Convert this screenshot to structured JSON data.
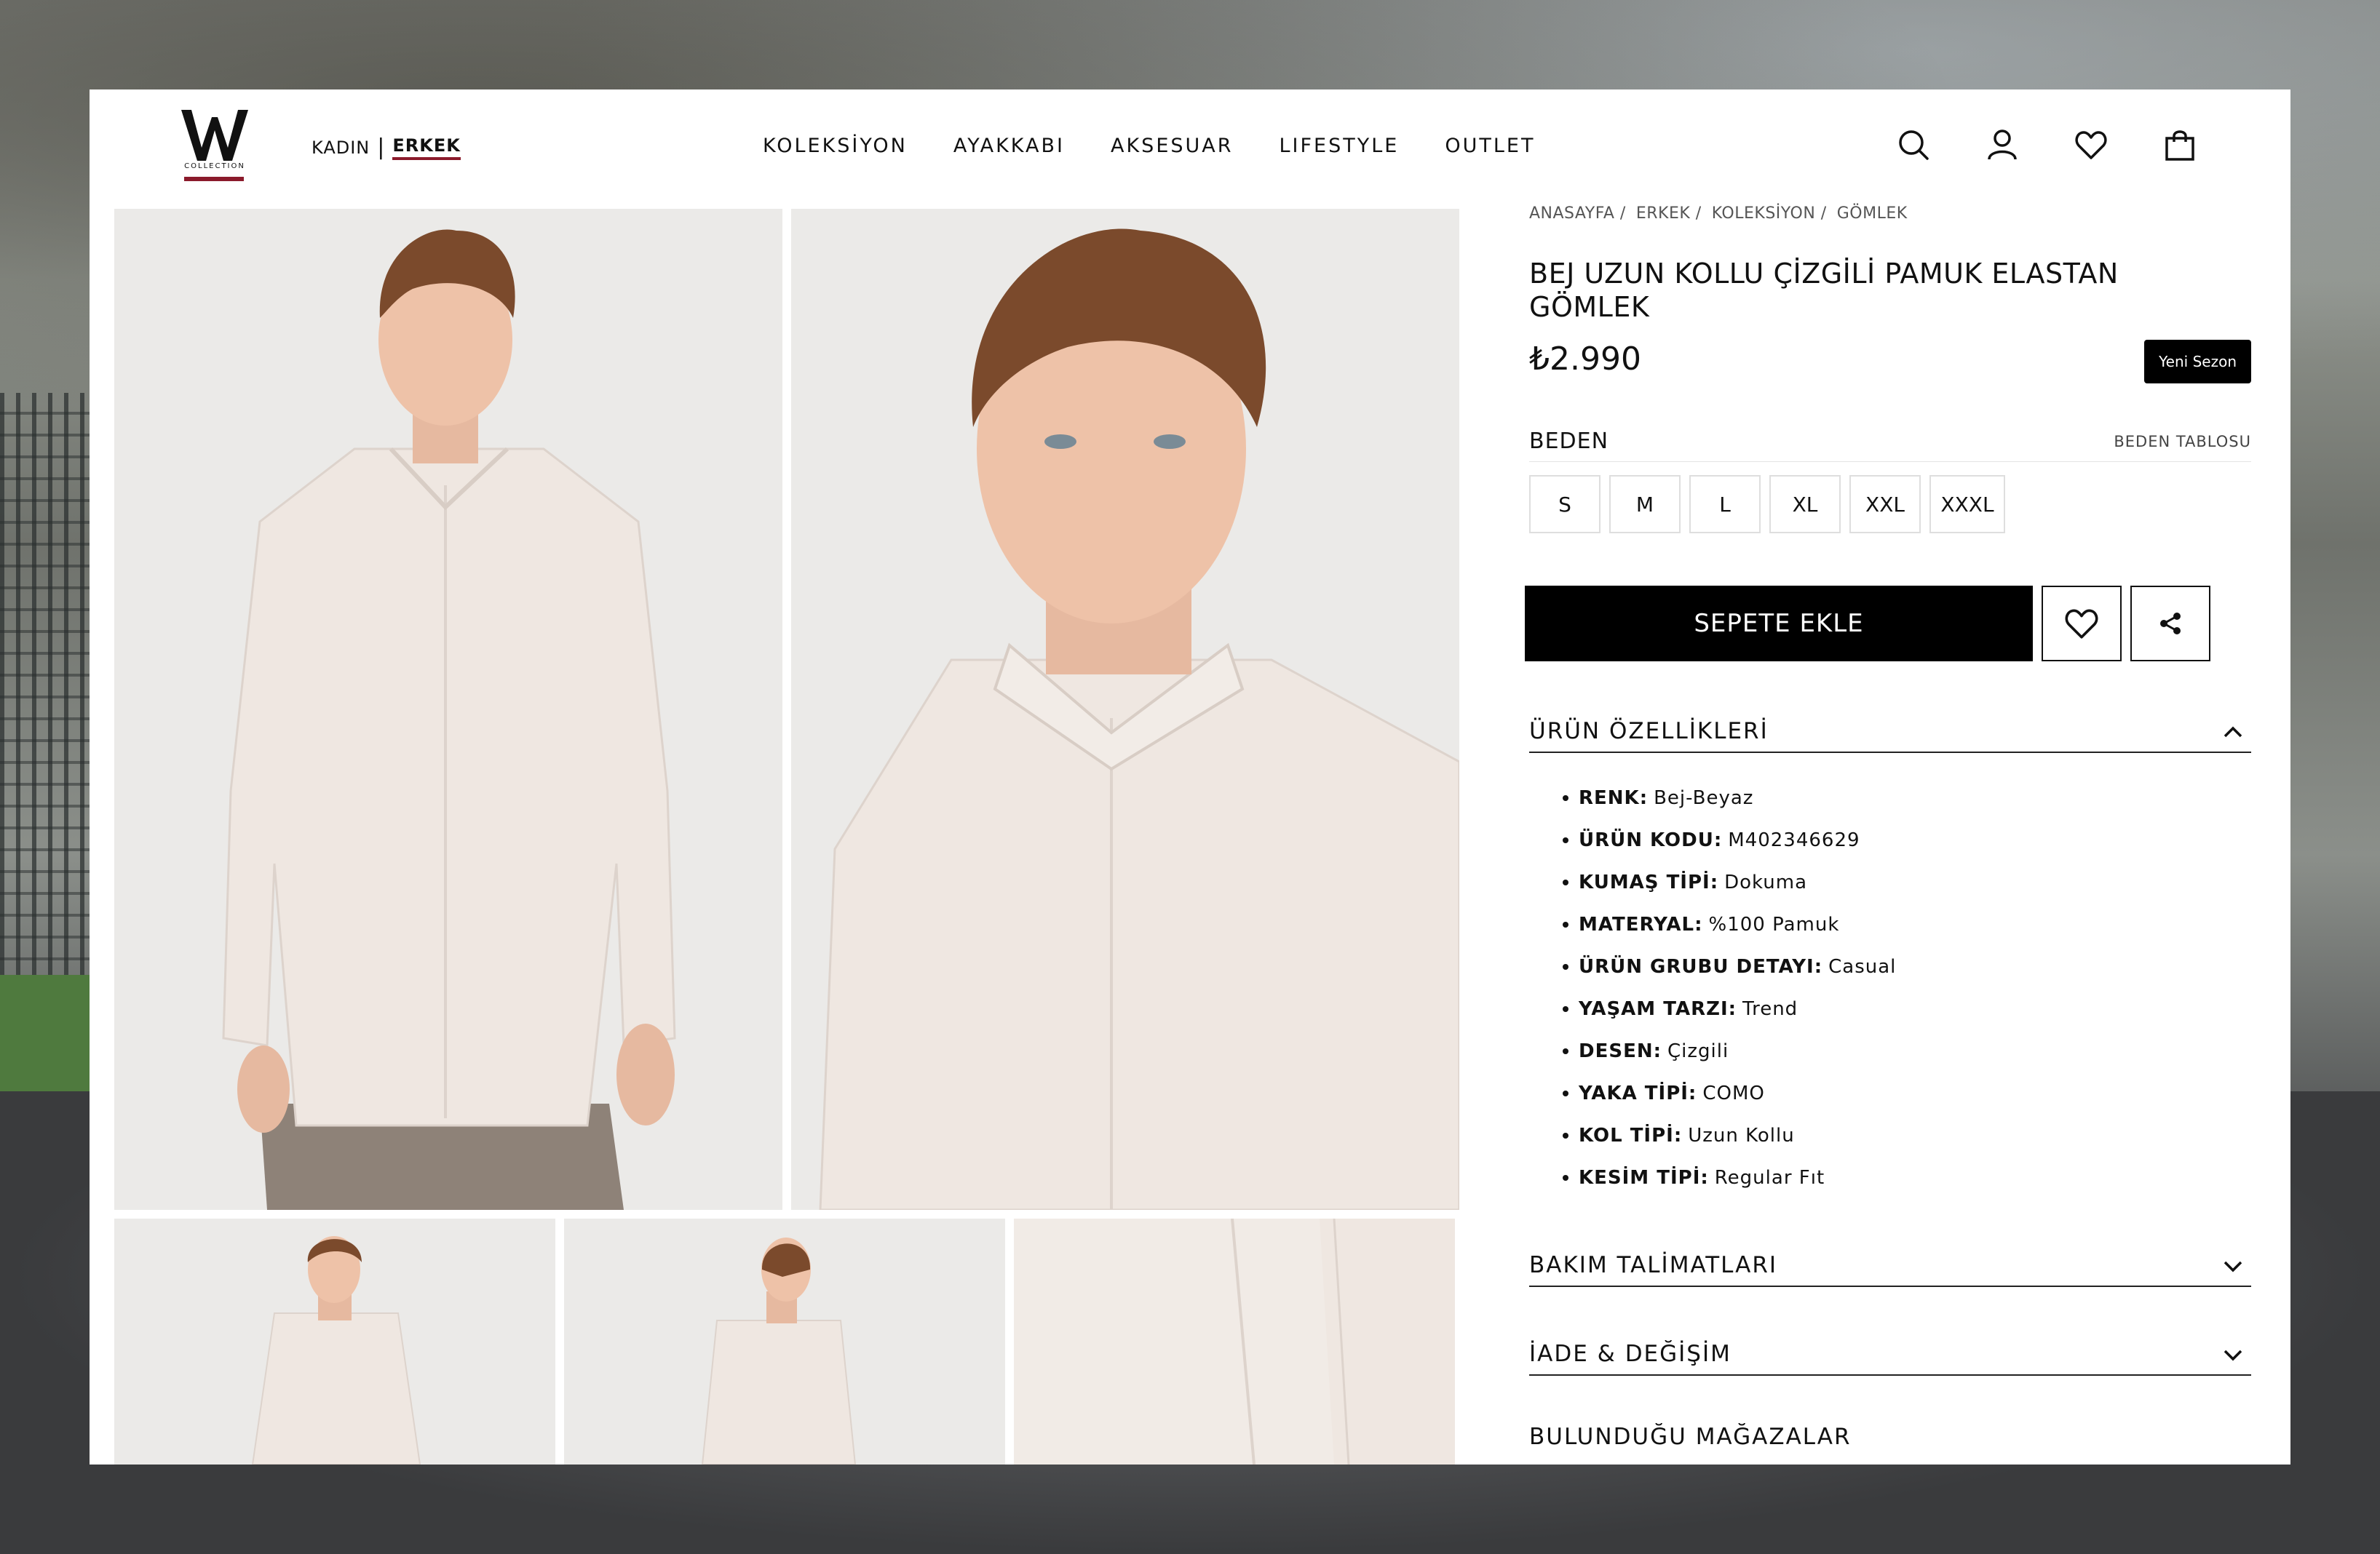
{
  "header": {
    "logo_letter": "W",
    "logo_sub": "COLLECTION",
    "gender": {
      "women": "KADIN",
      "men": "ERKEK"
    },
    "nav": [
      "KOLEKSİYON",
      "AYAKKABI",
      "AKSESUAR",
      "LIFESTYLE",
      "OUTLET"
    ],
    "icons": [
      "search-icon",
      "user-icon",
      "heart-icon",
      "shopping-bag-icon"
    ]
  },
  "breadcrumb": [
    "ANASAYFA",
    "ERKEK",
    "KOLEKSİYON",
    "GÖMLEK"
  ],
  "breadcrumb_sep": "/",
  "product": {
    "title": "BEJ UZUN KOLLU ÇİZGİLİ PAMUK ELASTAN GÖMLEK",
    "price": "₺2.990",
    "badge": "Yeni Sezon"
  },
  "size": {
    "label": "BEDEN",
    "table_link": "BEDEN TABLOSU",
    "options": [
      "S",
      "M",
      "L",
      "XL",
      "XXL",
      "XXXL"
    ]
  },
  "actions": {
    "add_to_cart": "SEPETE EKLE"
  },
  "accordion": {
    "features_title": "ÜRÜN ÖZELLİKLERİ",
    "features": [
      {
        "k": "RENK:",
        "v": "Bej-Beyaz"
      },
      {
        "k": "ÜRÜN KODU:",
        "v": "M402346629"
      },
      {
        "k": "KUMAŞ TİPİ:",
        "v": "Dokuma"
      },
      {
        "k": "MATERYAL:",
        "v": "%100 Pamuk"
      },
      {
        "k": "ÜRÜN GRUBU DETAYI:",
        "v": "Casual"
      },
      {
        "k": "YAŞAM TARZI:",
        "v": "Trend"
      },
      {
        "k": "DESEN:",
        "v": "Çizgili"
      },
      {
        "k": "YAKA TİPİ:",
        "v": "COMO"
      },
      {
        "k": "KOL TİPİ:",
        "v": "Uzun Kollu"
      },
      {
        "k": "KESİM TİPİ:",
        "v": "Regular Fıt"
      }
    ],
    "care_title": "BAKIM TALİMATLARI",
    "return_title": "İADE & DEĞİŞİM",
    "stores_title": "BULUNDUĞU MAĞAZALAR"
  },
  "colors": {
    "accent": "#8b1a2b",
    "button": "#000000",
    "shirt": "#efe7e1"
  }
}
